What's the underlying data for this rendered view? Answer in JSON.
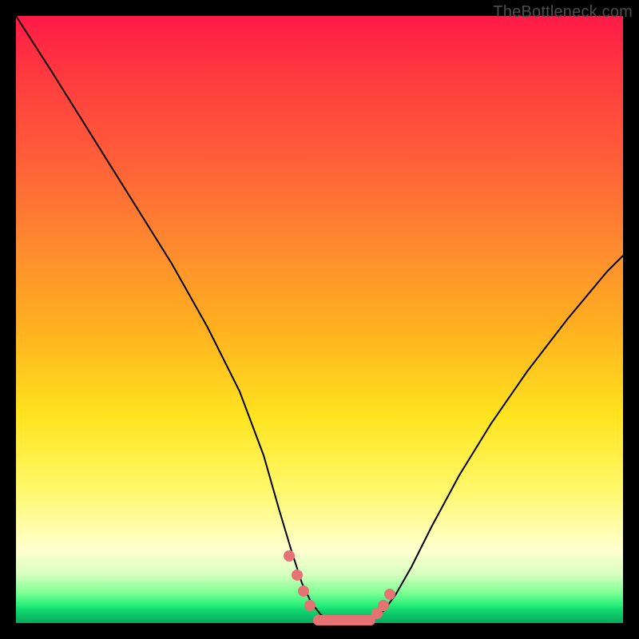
{
  "watermark": "TheBottleneck.com",
  "chart_data": {
    "type": "line",
    "title": "",
    "xlabel": "",
    "ylabel": "",
    "xlim": [
      0,
      100
    ],
    "ylim": [
      0,
      100
    ],
    "x": [
      0,
      5,
      10,
      15,
      20,
      25,
      30,
      35,
      40,
      43,
      46,
      49,
      52,
      55,
      58,
      61,
      64,
      68,
      72,
      76,
      80,
      85,
      90,
      95,
      100
    ],
    "y": [
      100,
      90,
      80,
      70,
      60,
      50,
      40,
      30,
      20,
      12,
      6,
      2,
      0,
      0,
      0,
      1,
      3,
      8,
      15,
      23,
      31,
      40,
      48,
      55,
      60
    ],
    "markers": {
      "type": "scatter",
      "x": [
        43,
        45,
        47,
        60,
        61,
        62
      ],
      "y": [
        9,
        6,
        4,
        1,
        2,
        4
      ]
    },
    "flat_segment": {
      "x_start": 48,
      "x_end": 58,
      "y": 0,
      "thickness": 2
    },
    "gradient_stops": [
      {
        "pos": 0.0,
        "color": "#ff1a47"
      },
      {
        "pos": 0.5,
        "color": "#ffb21f"
      },
      {
        "pos": 0.78,
        "color": "#fff86a"
      },
      {
        "pos": 0.95,
        "color": "#7dff94"
      },
      {
        "pos": 1.0,
        "color": "#07a85d"
      }
    ]
  }
}
